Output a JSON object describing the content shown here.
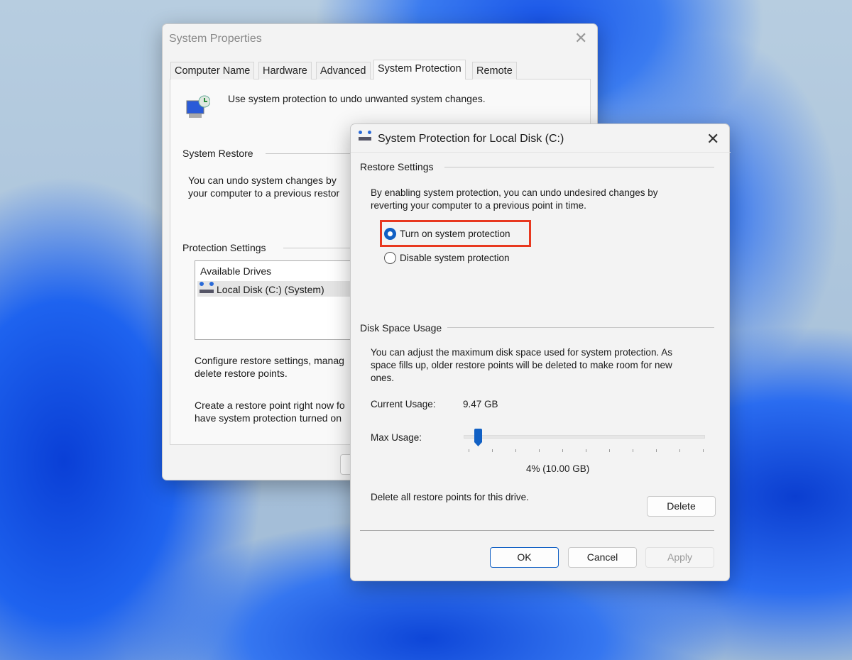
{
  "back_window": {
    "title": "System Properties",
    "tabs": [
      "Computer Name",
      "Hardware",
      "Advanced",
      "System Protection",
      "Remote"
    ],
    "active_tab": "System Protection",
    "intro": "Use system protection to undo unwanted system changes.",
    "system_restore_label": "System Restore",
    "system_restore_text1": "You can undo system changes by",
    "system_restore_text2": "your computer to a previous restor",
    "protection_settings_label": "Protection Settings",
    "drives_header": "Available Drives",
    "drive": "Local Disk (C:) (System)",
    "configure_text1": "Configure restore settings, manag",
    "configure_text2": "delete restore points.",
    "create_text1": "Create a restore point right now fo",
    "create_text2": "have system protection turned on"
  },
  "dialog": {
    "title": "System Protection for Local Disk (C:)",
    "restore_settings_label": "Restore Settings",
    "restore_desc1": "By enabling system protection, you can undo undesired changes by",
    "restore_desc2": "reverting your computer to a previous point in time.",
    "options": [
      {
        "label": "Turn on system protection",
        "selected": true
      },
      {
        "label": "Disable system protection",
        "selected": false
      }
    ],
    "highlight_color": "#e8381f",
    "disk_usage_label": "Disk Space Usage",
    "disk_desc1": "You can adjust the maximum disk space used for system protection. As",
    "disk_desc2": "space fills up, older restore points will be deleted to make room for new",
    "disk_desc3": "ones.",
    "current_usage_label": "Current Usage:",
    "current_usage_value": "9.47 GB",
    "max_usage_label": "Max Usage:",
    "max_usage_percent": 4,
    "max_usage_text": "4% (10.00 GB)",
    "delete_text": "Delete all restore points for this drive.",
    "delete_button": "Delete",
    "ok": "OK",
    "cancel": "Cancel",
    "apply": "Apply",
    "accent": "#1160c4"
  }
}
